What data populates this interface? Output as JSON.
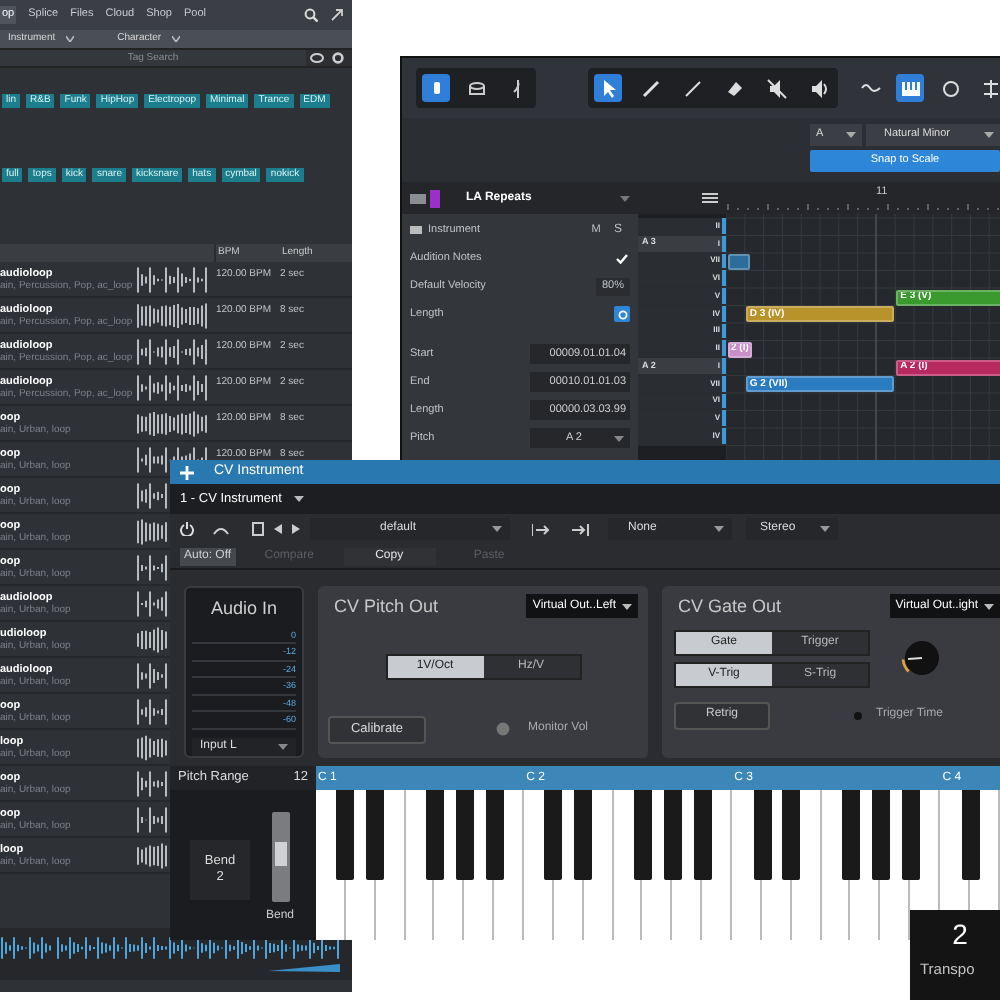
{
  "browser": {
    "tabs": [
      {
        "label": "op",
        "selected": true
      },
      {
        "label": "Splice",
        "selected": false
      },
      {
        "label": "Files",
        "selected": false
      },
      {
        "label": "Cloud",
        "selected": false
      },
      {
        "label": "Shop",
        "selected": false
      },
      {
        "label": "Pool",
        "selected": false
      }
    ],
    "filters": [
      "Instrument",
      "Character"
    ],
    "tag_search": {
      "placeholder": "Tag Search"
    },
    "tag_rows": [
      {
        "tags": [
          "lin",
          "R&B",
          "Funk",
          "HipHop",
          "Electropop",
          "Minimal",
          "Trance",
          "EDM"
        ]
      },
      {
        "tags": [
          "full",
          "tops",
          "kick",
          "snare",
          "kicksnare",
          "hats",
          "cymbal",
          "nokick"
        ]
      }
    ],
    "columns": [
      "BPM",
      "Length"
    ],
    "rows": [
      {
        "name": "audioloop",
        "tags": "ain, Percussion, Pop, ac_loop",
        "bpm": "120.00 BPM",
        "length": "2 sec"
      },
      {
        "name": "audioloop",
        "tags": "ain, Percussion, Pop, ac_loop",
        "bpm": "120.00 BPM",
        "length": "8 sec"
      },
      {
        "name": "audioloop",
        "tags": "ain, Percussion, Pop, ac_loop",
        "bpm": "120.00 BPM",
        "length": "2 sec"
      },
      {
        "name": "audioloop",
        "tags": "ain, Percussion, Pop, ac_loop",
        "bpm": "120.00 BPM",
        "length": "2 sec"
      },
      {
        "name": "oop",
        "tags": "ain, Urban, loop",
        "bpm": "120.00 BPM",
        "length": "8 sec"
      },
      {
        "name": "oop",
        "tags": "ain, Urban, loop",
        "bpm": "120.00 BPM",
        "length": "8 sec"
      },
      {
        "name": "oop",
        "tags": "ain, Urban, loop"
      },
      {
        "name": "oop",
        "tags": "ain, Urban, loop"
      },
      {
        "name": "oop",
        "tags": "ain, Urban, loop"
      },
      {
        "name": "audioloop",
        "tags": "ain, Urban, loop"
      },
      {
        "name": "udioloop",
        "tags": "ain, Urban, loop"
      },
      {
        "name": "audioloop",
        "tags": "ain, Urban, loop"
      },
      {
        "name": "oop",
        "tags": "ain, Urban, loop"
      },
      {
        "name": "loop",
        "tags": "ain, Urban, loop"
      },
      {
        "name": "oop",
        "tags": "ain, Urban, loop"
      },
      {
        "name": "oop",
        "tags": "ain, Urban, loop"
      },
      {
        "name": "loop",
        "tags": "ain, Urban, loop"
      }
    ]
  },
  "piano_roll": {
    "toolbar": [
      [
        {
          "selected": true
        },
        {
          "selected": false
        },
        {
          "selected": false
        }
      ],
      [
        {
          "selected": true
        },
        {
          "selected": false
        },
        {
          "selected": false
        },
        {
          "selected": false
        },
        {
          "selected": false
        },
        {
          "selected": false
        }
      ],
      [
        {
          "selected": false
        },
        {
          "selected": true
        },
        {
          "selected": false
        },
        {
          "selected": false
        }
      ]
    ],
    "key": "A",
    "scale": "Natural Minor",
    "snap_button": "Snap to Scale",
    "track_name": "LA Repeats",
    "ruler": "11",
    "inspector": [
      {
        "kind": "header",
        "label": "Instrument",
        "m": "M",
        "s": "S"
      },
      {
        "kind": "check",
        "label": "Audition Notes",
        "checked": true
      },
      {
        "kind": "value",
        "label": "Default Velocity",
        "value": "80%"
      },
      {
        "kind": "toggle",
        "label": "Length",
        "on": true
      },
      {
        "kind": "field",
        "label": "Start",
        "value": "00009.01.01.04"
      },
      {
        "kind": "field",
        "label": "End",
        "value": "00010.01.01.03"
      },
      {
        "kind": "field",
        "label": "Length",
        "value": "00000.03.03.99"
      },
      {
        "kind": "select",
        "label": "Pitch",
        "value": "A 2"
      }
    ],
    "keys": [
      {
        "degree": "II"
      },
      {
        "degree": "I",
        "note": "A 3"
      },
      {
        "degree": "VII"
      },
      {
        "degree": "VI"
      },
      {
        "degree": "V"
      },
      {
        "degree": "IV"
      },
      {
        "degree": "III"
      },
      {
        "degree": "II"
      },
      {
        "degree": "I",
        "note": "A 2"
      },
      {
        "degree": "VII"
      },
      {
        "degree": "VI"
      },
      {
        "degree": "V"
      },
      {
        "degree": "IV"
      }
    ],
    "notes": [
      {
        "color": "#2c6d9c"
      },
      {
        "label": "E 3 (V)",
        "color": "#3a9a2e"
      },
      {
        "label": "D 3 (IV)",
        "color": "#b8922a"
      },
      {
        "label": "2 (I)",
        "color": "#c98fcb"
      },
      {
        "label": "A 2 (I)",
        "color": "#b8295f"
      },
      {
        "label": "G 2 (VII)",
        "color": "#2b7bc0"
      }
    ]
  },
  "cv_instrument": {
    "title": "CV Instrument",
    "instance": "1 - CV Instrument",
    "preset": "default",
    "sidechain": "None",
    "channels": "Stereo",
    "auto": "Auto: Off",
    "preset_actions": [
      {
        "label": "Compare",
        "disabled": true
      },
      {
        "label": "Copy",
        "disabled": false
      },
      {
        "label": "Paste",
        "disabled": true
      }
    ],
    "audio_in": {
      "title": "Audio In",
      "scale": [
        "0",
        "-12",
        "-24",
        "-36",
        "-48",
        "-60"
      ],
      "input": "Input L"
    },
    "pitch_out": {
      "title": "CV Pitch Out",
      "output": "Virtual Out..Left",
      "modes": [
        {
          "label": "1V/Oct",
          "selected": true
        },
        {
          "label": "Hz/V",
          "selected": false
        }
      ],
      "calibrate": "Calibrate",
      "monitor": "Monitor Vol"
    },
    "gate_out": {
      "title": "CV Gate Out",
      "output": "Virtual Out..ight",
      "gate_modes": [
        {
          "label": "Gate",
          "selected": true
        },
        {
          "label": "Trigger",
          "selected": false
        }
      ],
      "trig_modes": [
        {
          "label": "V-Trig",
          "selected": true
        },
        {
          "label": "S-Trig",
          "selected": false
        }
      ],
      "retrig": "Retrig",
      "trigger_time": {
        "label": "Trigger Time",
        "level": 0.15
      }
    },
    "pitch_range": {
      "label": "Pitch Range",
      "value": "12"
    },
    "octaves": [
      "C 1",
      "C 2",
      "C 3",
      "C 4"
    ],
    "bend": {
      "label": "Bend",
      "value": "2",
      "slider_label": "Bend"
    }
  },
  "transpose": {
    "value": "2",
    "label": "Transpo"
  }
}
